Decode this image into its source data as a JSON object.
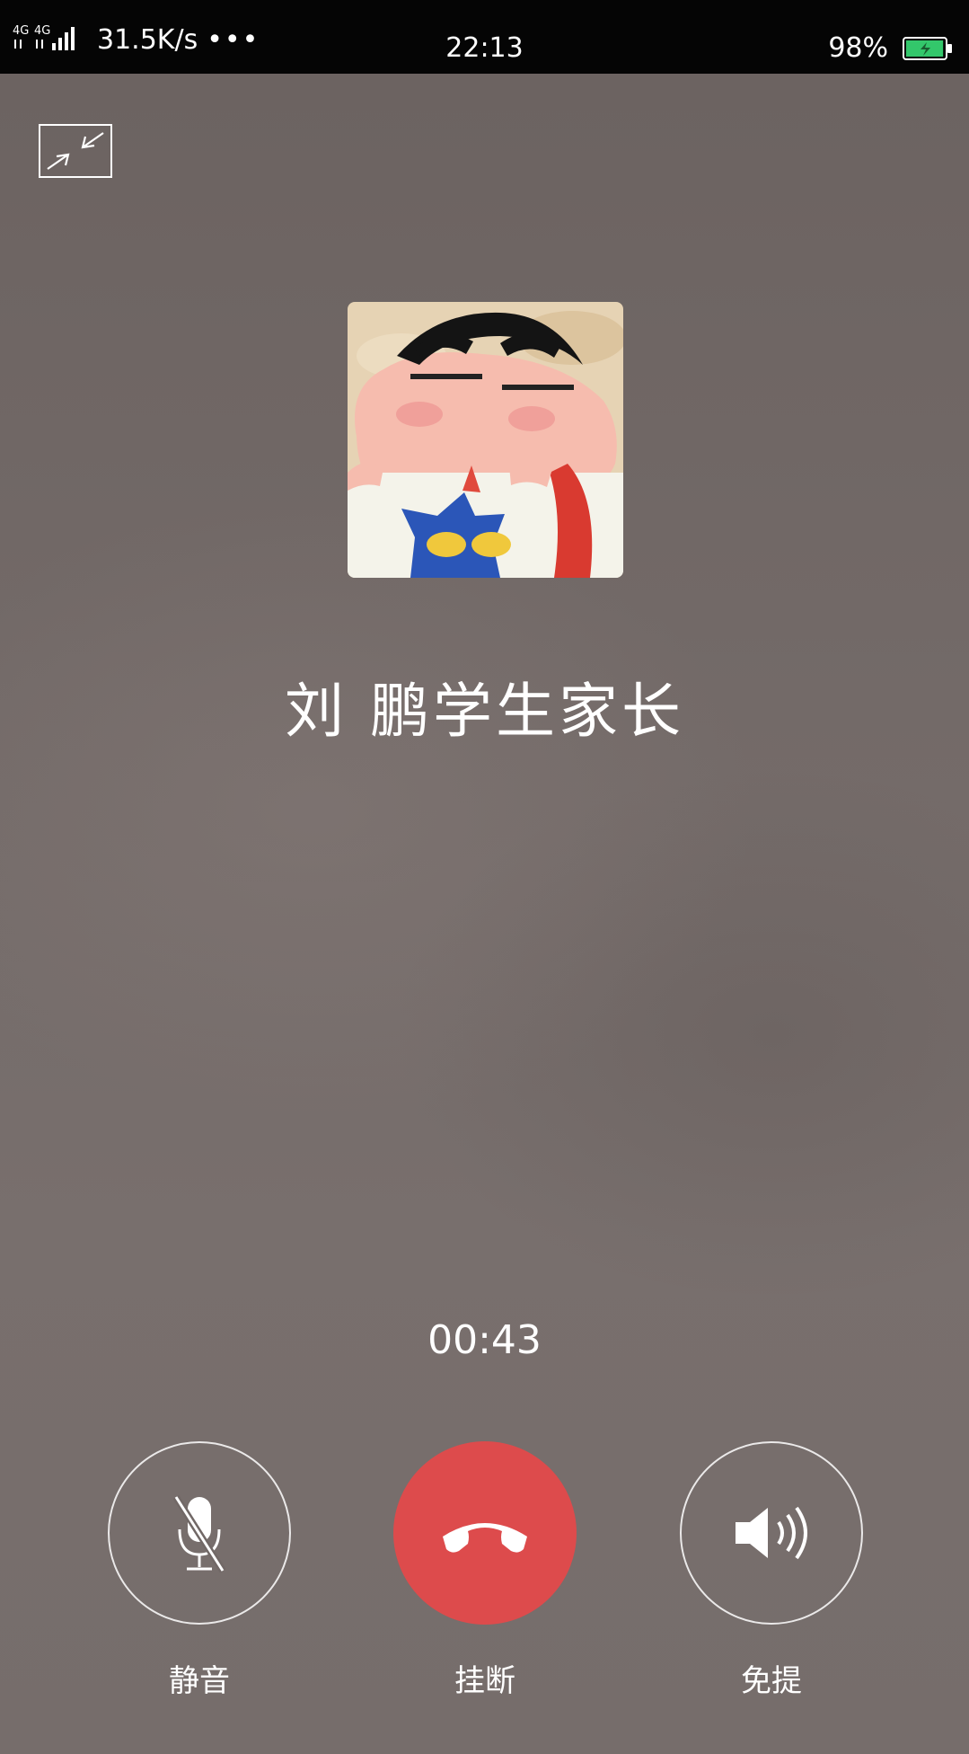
{
  "status_bar": {
    "network": "4G 4G",
    "net_speed": "31.5K/s",
    "more": "•••",
    "time": "22:13",
    "battery_pct": "98%",
    "battery_level": 0.98
  },
  "call": {
    "caller_name": "刘 鹏学生家长",
    "duration": "00:43"
  },
  "controls": {
    "mute_label": "静音",
    "hangup_label": "挂断",
    "speaker_label": "免提",
    "hangup_color": "#dd4b4c"
  },
  "icons": {
    "minimize": "minimize-icon",
    "mute": "mic-off-icon",
    "hangup": "phone-hangup-icon",
    "speaker": "speaker-icon",
    "battery": "battery-charging-icon"
  }
}
